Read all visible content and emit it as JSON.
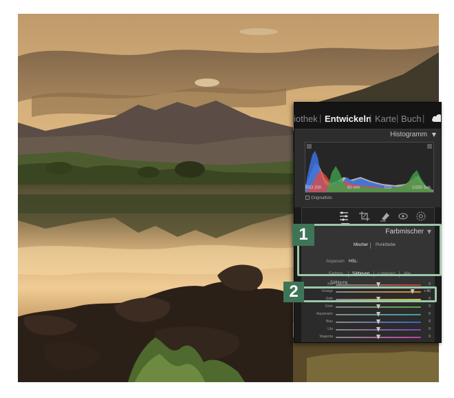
{
  "modules": {
    "items": [
      {
        "label": "iothek",
        "active": false
      },
      {
        "label": "Entwickeln",
        "active": true
      },
      {
        "label": "Karte",
        "active": false
      },
      {
        "label": "Buch",
        "active": false
      }
    ],
    "separator": "|",
    "cloud_icon": "cloud-icon"
  },
  "histogram": {
    "title": "Histogramm",
    "exif": {
      "iso": "ISO 200",
      "focal": "60 mm",
      "aperture": "f/10",
      "shutter": "1/250 Sek."
    },
    "original_label": "Originalfoto",
    "series_colors": {
      "red": "#e34a3b",
      "green": "#3fa048",
      "blue": "#3a6fd8",
      "gray": "#c8c8c8"
    }
  },
  "tools": [
    "edit-sliders-icon",
    "crop-icon",
    "healing-icon",
    "redeye-icon",
    "mask-icon"
  ],
  "farbmischer": {
    "title": "Farbmischer",
    "modes": {
      "mixer": "Mischer",
      "point": "Punktfarbe"
    },
    "adjust": {
      "label": "Anpassen",
      "value": "HSL"
    },
    "tabs": [
      "Farbton",
      "Sättigung",
      "Luminanz",
      "Alle"
    ],
    "active_tab": "Sättigung"
  },
  "saturation": {
    "title": "Sättigung",
    "rows": [
      {
        "label": "Rot",
        "value": "0",
        "track": "#c53b3b",
        "fraction": 0.5
      },
      {
        "label": "Orange",
        "value": "+ 80",
        "track": "#d98a2e",
        "fraction": 0.9
      },
      {
        "label": "Gelb",
        "value": "0",
        "track": "#cfc340",
        "fraction": 0.5
      },
      {
        "label": "Grün",
        "value": "0",
        "track": "#59a843",
        "fraction": 0.5
      },
      {
        "label": "Aquamarin",
        "value": "0",
        "track": "#3aa5a1",
        "fraction": 0.5
      },
      {
        "label": "Blau",
        "value": "0",
        "track": "#3a63c8",
        "fraction": 0.5
      },
      {
        "label": "Lila",
        "value": "0",
        "track": "#7a46c0",
        "fraction": 0.5
      },
      {
        "label": "Magenta",
        "value": "0",
        "track": "#c142a6",
        "fraction": 0.5
      }
    ]
  },
  "callouts": [
    {
      "label": "1"
    },
    {
      "label": "2"
    }
  ],
  "accent_color": "#3f7557"
}
